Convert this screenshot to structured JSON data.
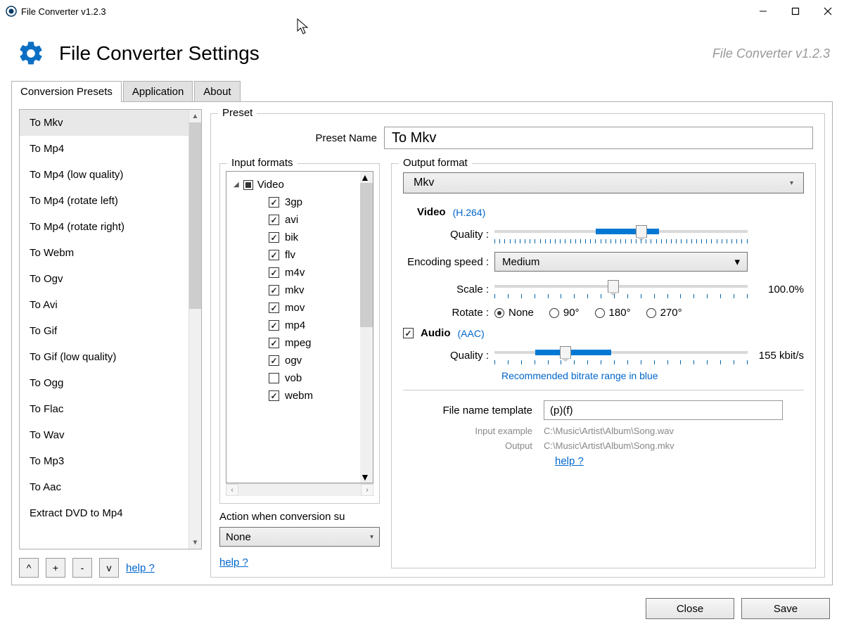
{
  "window": {
    "title": "File Converter v1.2.3"
  },
  "header": {
    "title": "File Converter Settings",
    "version": "File Converter v1.2.3"
  },
  "tabs": {
    "presets": "Conversion Presets",
    "application": "Application",
    "about": "About"
  },
  "presets": {
    "items": [
      "To Mkv",
      "To Mp4",
      "To Mp4 (low quality)",
      "To Mp4 (rotate left)",
      "To Mp4 (rotate right)",
      "To Webm",
      "To Ogv",
      "To Avi",
      "To Gif",
      "To Gif (low quality)",
      "To Ogg",
      "To Flac",
      "To Wav",
      "To Mp3",
      "To Aac",
      "Extract DVD to Mp4"
    ],
    "toolbar": {
      "up": "^",
      "add": "+",
      "remove": "-",
      "down": "v",
      "help": "help ?"
    }
  },
  "preset_panel": {
    "legend": "Preset",
    "name_label": "Preset Name",
    "name_value": "To Mkv"
  },
  "input_formats": {
    "legend": "Input formats",
    "group": "Video",
    "items": [
      {
        "label": "3gp",
        "checked": true
      },
      {
        "label": "avi",
        "checked": true
      },
      {
        "label": "bik",
        "checked": true
      },
      {
        "label": "flv",
        "checked": true
      },
      {
        "label": "m4v",
        "checked": true
      },
      {
        "label": "mkv",
        "checked": true
      },
      {
        "label": "mov",
        "checked": true
      },
      {
        "label": "mp4",
        "checked": true
      },
      {
        "label": "mpeg",
        "checked": true
      },
      {
        "label": "ogv",
        "checked": true
      },
      {
        "label": "vob",
        "checked": false
      },
      {
        "label": "webm",
        "checked": true
      }
    ],
    "action_label": "Action when conversion su",
    "action_value": "None",
    "help": "help ?"
  },
  "output": {
    "legend": "Output format",
    "format": "Mkv",
    "video": {
      "label": "Video",
      "codec": "(H.264)",
      "quality_label": "Quality :",
      "encoding_label": "Encoding speed :",
      "encoding_value": "Medium",
      "scale_label": "Scale :",
      "scale_value": "100.0%",
      "rotate_label": "Rotate :",
      "rotate_options": [
        "None",
        "90°",
        "180°",
        "270°"
      ],
      "rotate_selected": "None"
    },
    "audio": {
      "label": "Audio",
      "codec": "(AAC)",
      "checked": true,
      "quality_label": "Quality :",
      "quality_value": "155 kbit/s",
      "note": "Recommended bitrate range in blue"
    },
    "fnt": {
      "label": "File name template",
      "value": "(p)(f)",
      "input_ex_label": "Input example",
      "input_ex": "C:\\Music\\Artist\\Album\\Song.wav",
      "output_ex_label": "Output",
      "output_ex": "C:\\Music\\Artist\\Album\\Song.mkv",
      "help": "help ?"
    }
  },
  "footer": {
    "close": "Close",
    "save": "Save"
  }
}
